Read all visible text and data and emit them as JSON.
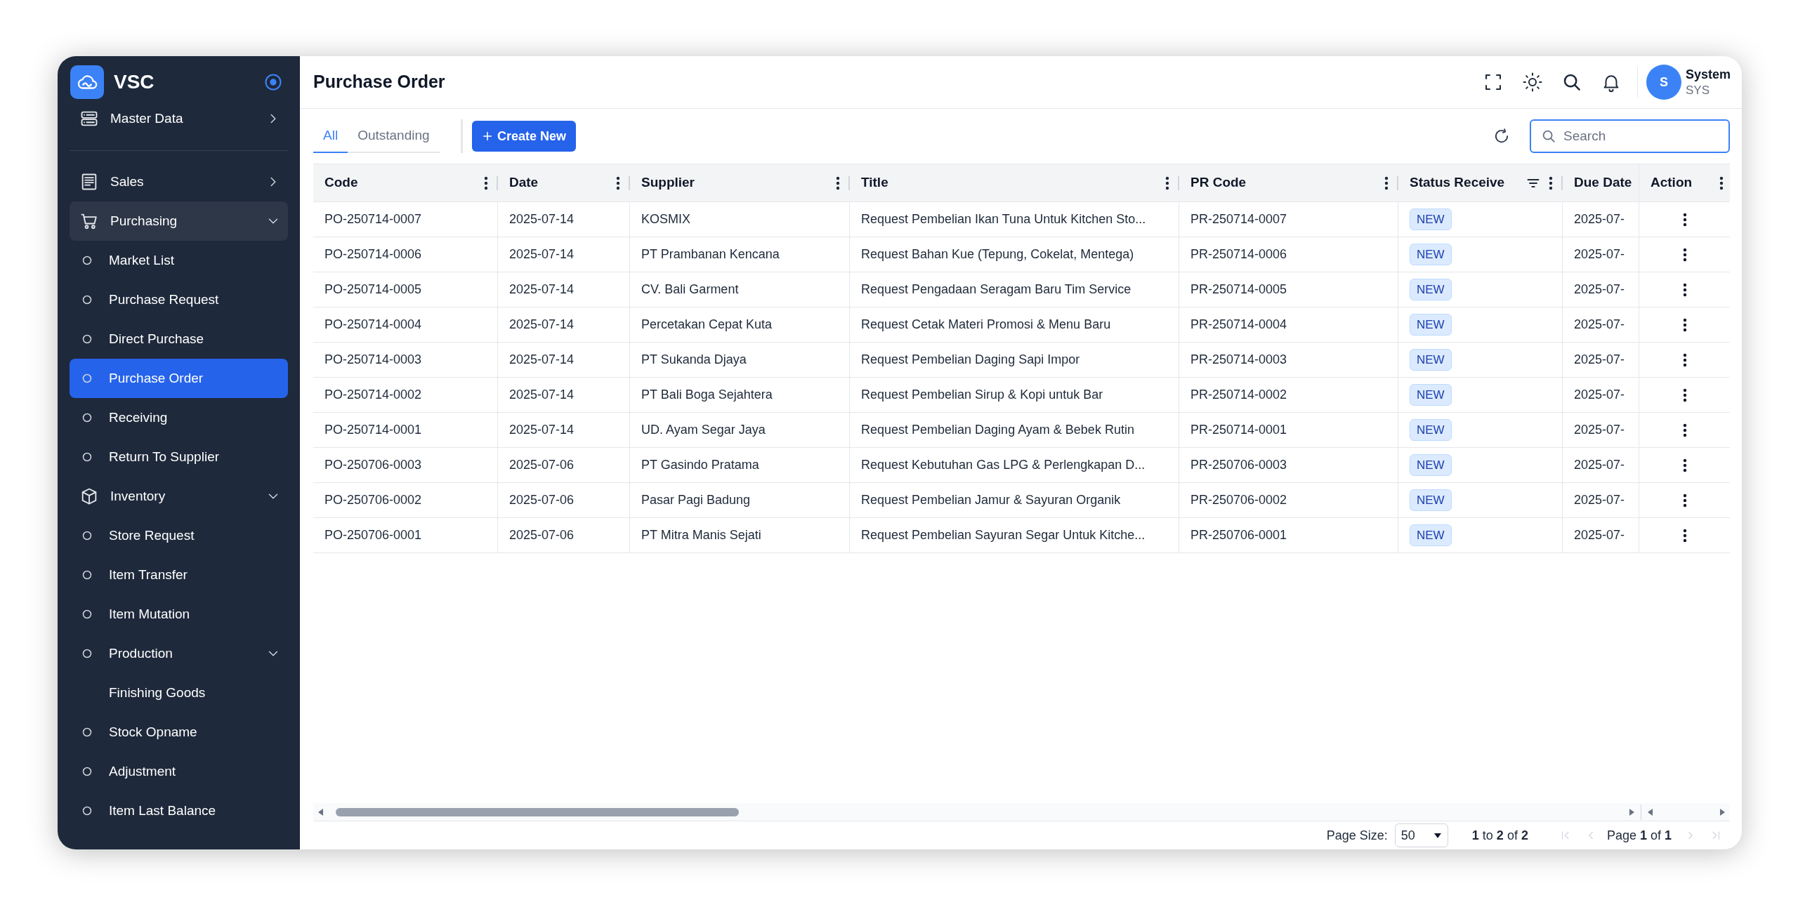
{
  "brand": {
    "name": "VSC"
  },
  "sidebar": {
    "sections": [
      {
        "items": [
          {
            "label": "Master Data",
            "active": false,
            "expanded": false
          }
        ]
      },
      {
        "items": [
          {
            "label": "Sales",
            "active": false,
            "expanded": false
          },
          {
            "label": "Purchasing",
            "active": true,
            "expanded": true,
            "children": [
              {
                "label": "Market List",
                "selected": false
              },
              {
                "label": "Purchase Request",
                "selected": false
              },
              {
                "label": "Direct Purchase",
                "selected": false
              },
              {
                "label": "Purchase Order",
                "selected": true
              },
              {
                "label": "Receiving",
                "selected": false
              },
              {
                "label": "Return To Supplier",
                "selected": false
              }
            ]
          },
          {
            "label": "Inventory",
            "active": false,
            "expanded": true,
            "children": [
              {
                "label": "Store Request",
                "selected": false
              },
              {
                "label": "Item Transfer",
                "selected": false
              },
              {
                "label": "Item Mutation",
                "selected": false
              },
              {
                "label": "Production",
                "selected": false,
                "expanded": true,
                "children": [
                  {
                    "label": "Finishing Goods",
                    "selected": false
                  }
                ]
              },
              {
                "label": "Stock Opname",
                "selected": false
              },
              {
                "label": "Adjustment",
                "selected": false
              },
              {
                "label": "Item Last Balance",
                "selected": false
              }
            ]
          }
        ]
      }
    ]
  },
  "header": {
    "title": "Purchase Order",
    "user": {
      "initial": "S",
      "name": "System",
      "code": "SYS"
    }
  },
  "tabs": [
    {
      "label": "All",
      "selected": true
    },
    {
      "label": "Outstanding",
      "selected": false
    }
  ],
  "create_button": {
    "label": "Create New"
  },
  "search": {
    "placeholder": "Search"
  },
  "table": {
    "columns": [
      {
        "label": "Code",
        "menu": true,
        "filter": false
      },
      {
        "label": "Date",
        "menu": true,
        "filter": false
      },
      {
        "label": "Supplier",
        "menu": true,
        "filter": false
      },
      {
        "label": "Title",
        "menu": true,
        "filter": false
      },
      {
        "label": "PR Code",
        "menu": true,
        "filter": false
      },
      {
        "label": "Status Receive",
        "menu": true,
        "filter": true
      },
      {
        "label": "Due Date"
      },
      {
        "label": "Action",
        "menu": true,
        "filter": false
      }
    ],
    "rows": [
      {
        "code": "PO-250714-0007",
        "date": "2025-07-14",
        "supplier": "KOSMIX",
        "title": "Request Pembelian Ikan Tuna Untuk Kitchen Sto...",
        "pr_code": "PR-250714-0007",
        "status": "NEW",
        "due_date": "2025-07-"
      },
      {
        "code": "PO-250714-0006",
        "date": "2025-07-14",
        "supplier": "PT Prambanan Kencana",
        "title": "Request Bahan Kue (Tepung, Cokelat, Mentega)",
        "pr_code": "PR-250714-0006",
        "status": "NEW",
        "due_date": "2025-07-"
      },
      {
        "code": "PO-250714-0005",
        "date": "2025-07-14",
        "supplier": "CV. Bali Garment",
        "title": "Request Pengadaan Seragam Baru Tim Service",
        "pr_code": "PR-250714-0005",
        "status": "NEW",
        "due_date": "2025-07-"
      },
      {
        "code": "PO-250714-0004",
        "date": "2025-07-14",
        "supplier": "Percetakan Cepat Kuta",
        "title": "Request Cetak Materi Promosi & Menu Baru",
        "pr_code": "PR-250714-0004",
        "status": "NEW",
        "due_date": "2025-07-"
      },
      {
        "code": "PO-250714-0003",
        "date": "2025-07-14",
        "supplier": "PT Sukanda Djaya",
        "title": "Request Pembelian Daging Sapi Impor",
        "pr_code": "PR-250714-0003",
        "status": "NEW",
        "due_date": "2025-07-"
      },
      {
        "code": "PO-250714-0002",
        "date": "2025-07-14",
        "supplier": "PT Bali Boga Sejahtera",
        "title": "Request Pembelian Sirup & Kopi untuk Bar",
        "pr_code": "PR-250714-0002",
        "status": "NEW",
        "due_date": "2025-07-"
      },
      {
        "code": "PO-250714-0001",
        "date": "2025-07-14",
        "supplier": "UD. Ayam Segar Jaya",
        "title": "Request Pembelian Daging Ayam & Bebek Rutin",
        "pr_code": "PR-250714-0001",
        "status": "NEW",
        "due_date": "2025-07-"
      },
      {
        "code": "PO-250706-0003",
        "date": "2025-07-06",
        "supplier": "PT Gasindo Pratama",
        "title": "Request Kebutuhan Gas LPG & Perlengkapan D...",
        "pr_code": "PR-250706-0003",
        "status": "NEW",
        "due_date": "2025-07-"
      },
      {
        "code": "PO-250706-0002",
        "date": "2025-07-06",
        "supplier": "Pasar Pagi Badung",
        "title": "Request Pembelian Jamur & Sayuran Organik",
        "pr_code": "PR-250706-0002",
        "status": "NEW",
        "due_date": "2025-07-"
      },
      {
        "code": "PO-250706-0001",
        "date": "2025-07-06",
        "supplier": "PT Mitra Manis Sejati",
        "title": "Request Pembelian Sayuran Segar Untuk Kitche...",
        "pr_code": "PR-250706-0001",
        "status": "NEW",
        "due_date": "2025-07-"
      }
    ]
  },
  "pagination": {
    "page_size_label": "Page Size:",
    "page_size": "50",
    "range": "**1** to **2** of **2**",
    "page": "Page **1** of **1**"
  }
}
